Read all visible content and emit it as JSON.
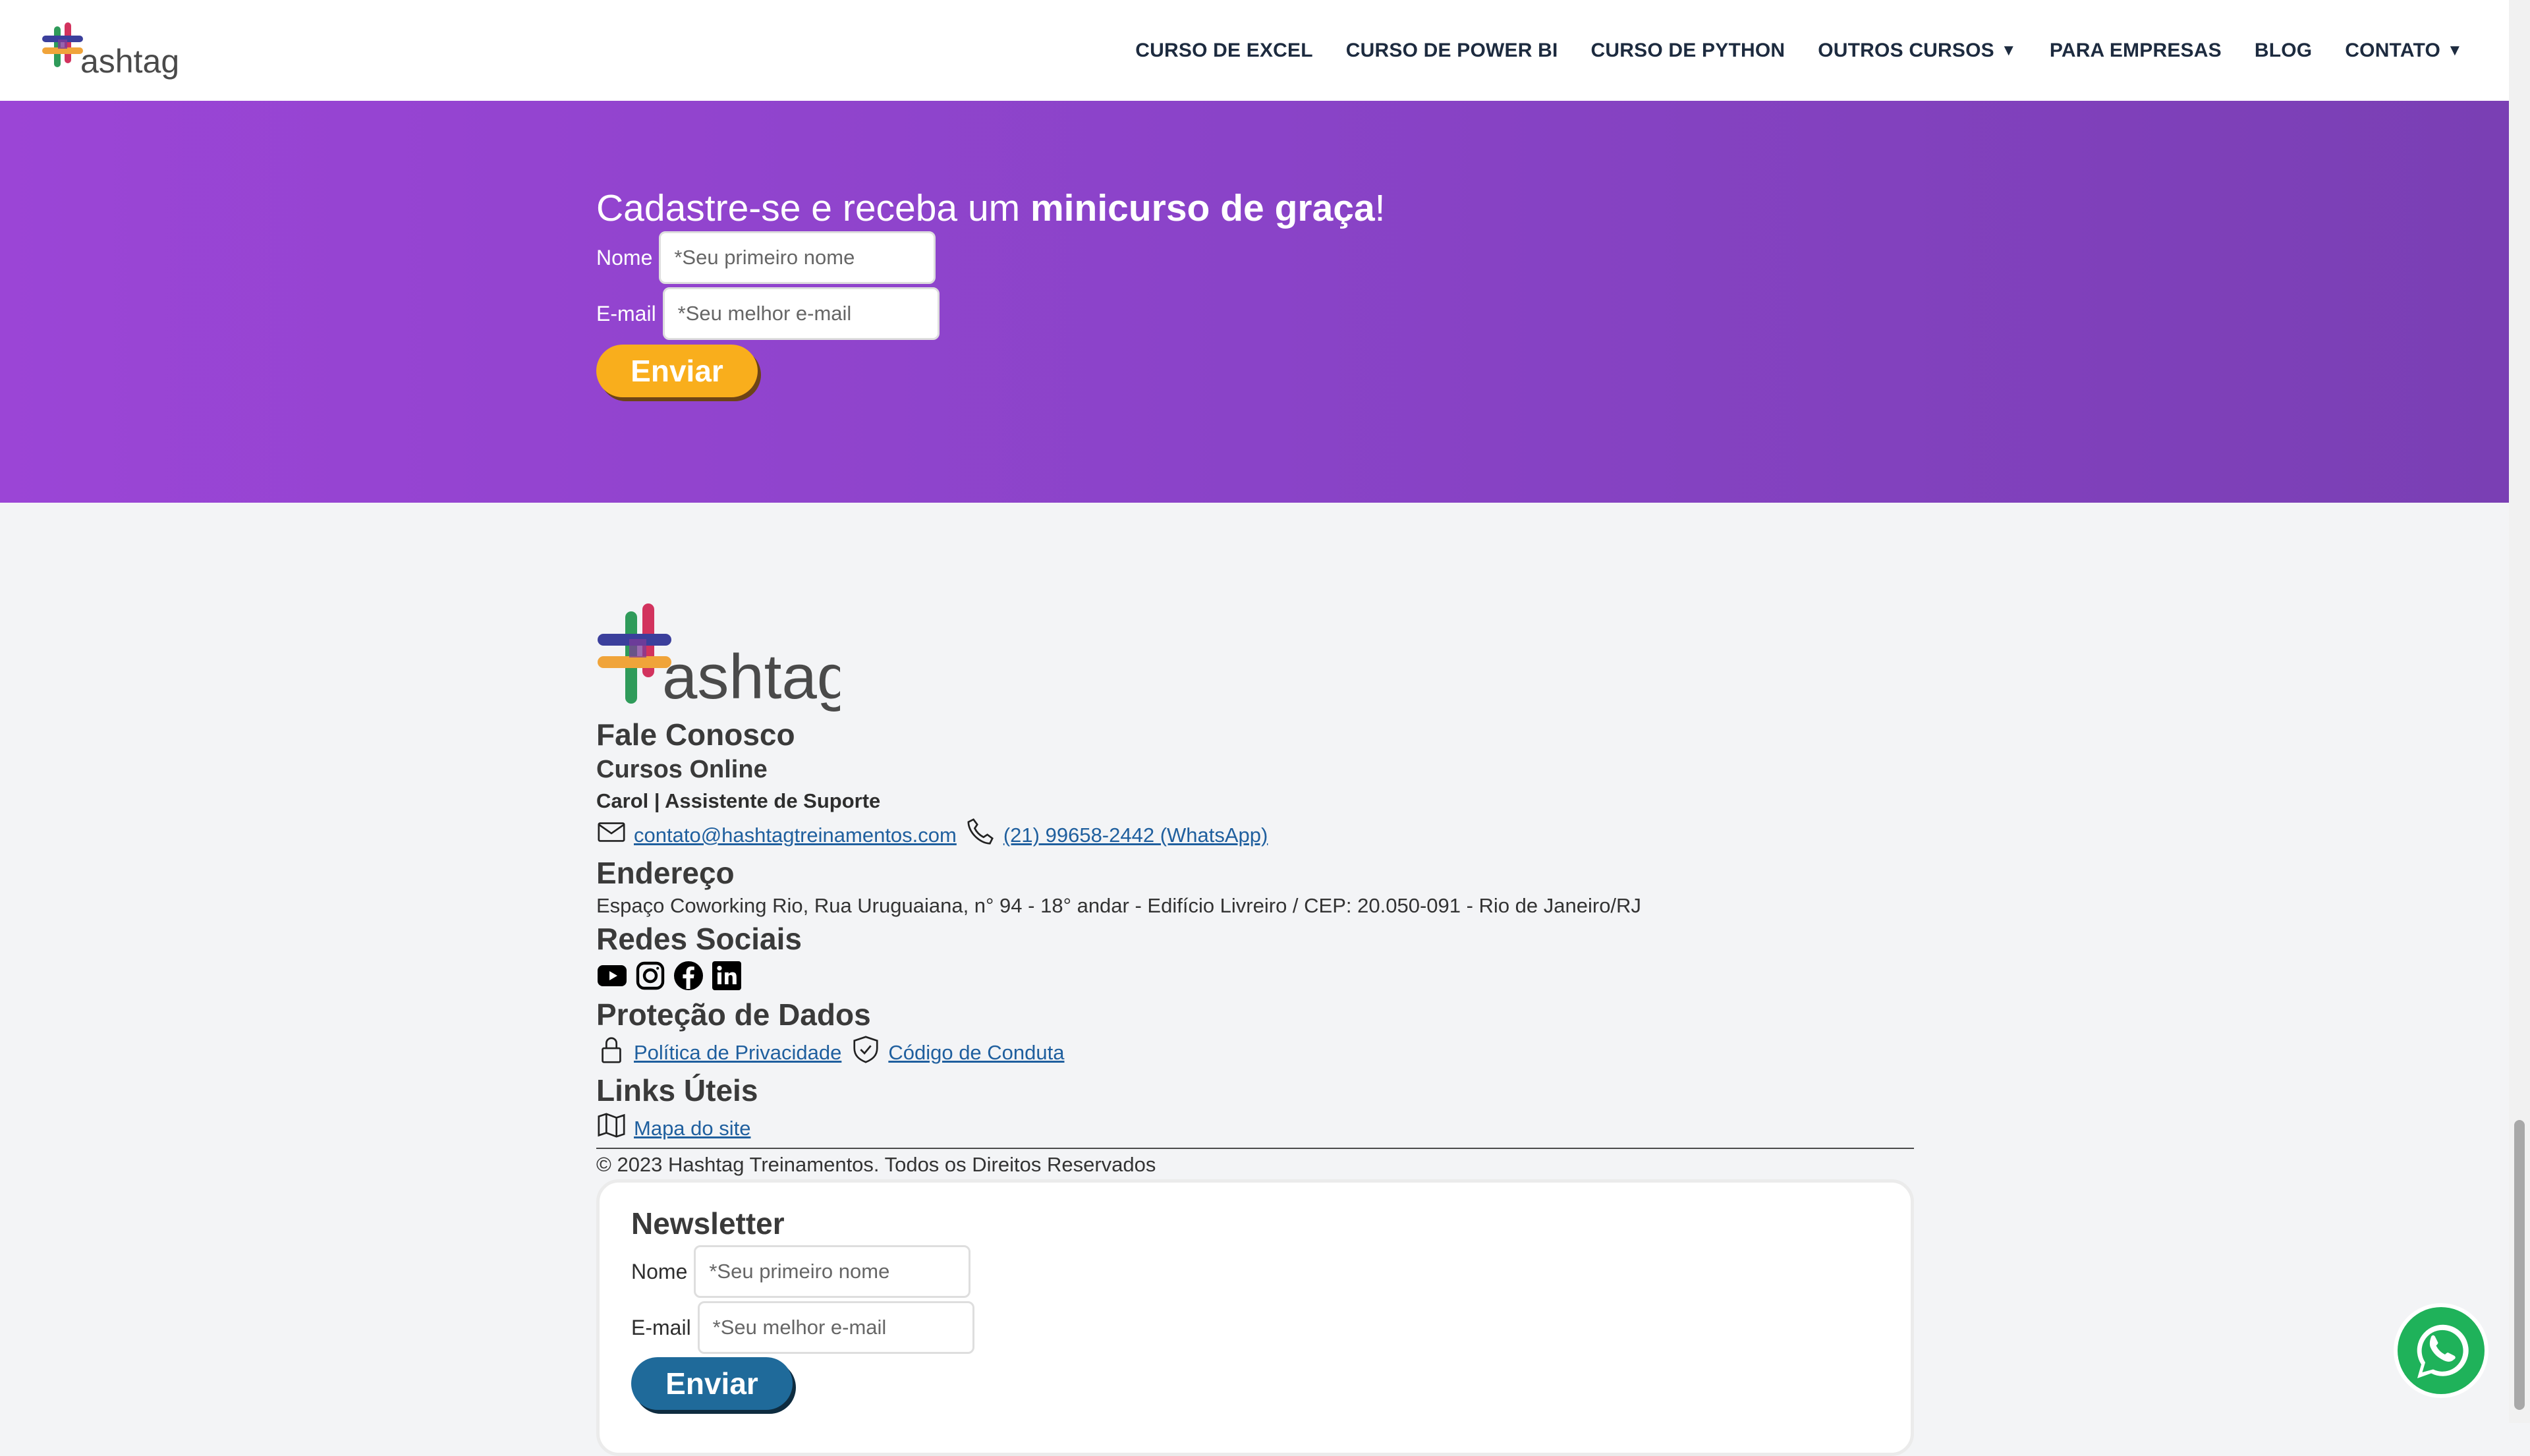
{
  "brand": {
    "colors": {
      "purple": "#8a43c8",
      "yellow": "#f9ae1c",
      "blue": "#1f6a9a",
      "link": "#1f5f9e"
    }
  },
  "header": {
    "logo_icon": "hashtag-logo",
    "logo_text": "ashtag",
    "nav": {
      "excel": "CURSO DE EXCEL",
      "powerbi": "CURSO DE POWER BI",
      "python": "CURSO DE PYTHON",
      "outros": "OUTROS CURSOS",
      "empresas": "PARA EMPRESAS",
      "blog": "BLOG",
      "contato": "CONTATO"
    },
    "caret": "▼"
  },
  "signup": {
    "title_prefix": "Cadastre-se e receba um ",
    "title_bold": "minicurso de graça",
    "title_suffix": "!",
    "name_label": "Nome",
    "name_placeholder": "*Seu primeiro nome",
    "email_label": "E-mail",
    "email_placeholder": "*Seu melhor e-mail",
    "submit": "Enviar"
  },
  "footer": {
    "logo_text": "ashtag",
    "contact_heading": "Fale Conosco",
    "contact_sub": "Cursos Online",
    "contact_person": "Carol | Assistente de Suporte",
    "email": "contato@hashtagtreinamentos.com",
    "phone": "(21) 99658-2442 (WhatsApp)",
    "address_heading": "Endereço",
    "address": "Espaço Coworking Rio, Rua Uruguaiana, n° 94 - 18° andar - Edifício Livreiro / CEP: 20.050-091 - Rio de Janeiro/RJ",
    "social_heading": "Redes Sociais",
    "social_icons": [
      "youtube-icon",
      "instagram-icon",
      "facebook-icon",
      "linkedin-icon"
    ],
    "privacy_heading": "Proteção de Dados",
    "privacy_link": "Política de Privacidade",
    "conduct_link": "Código de Conduta",
    "links_heading": "Links Úteis",
    "sitemap_link": "Mapa do site",
    "copyright": "© 2023 Hashtag Treinamentos. Todos os Direitos Reservados"
  },
  "newsletter": {
    "title": "Newsletter",
    "name_label": "Nome",
    "name_placeholder": "*Seu primeiro nome",
    "email_label": "E-mail",
    "email_placeholder": "*Seu melhor e-mail",
    "submit": "Enviar"
  }
}
